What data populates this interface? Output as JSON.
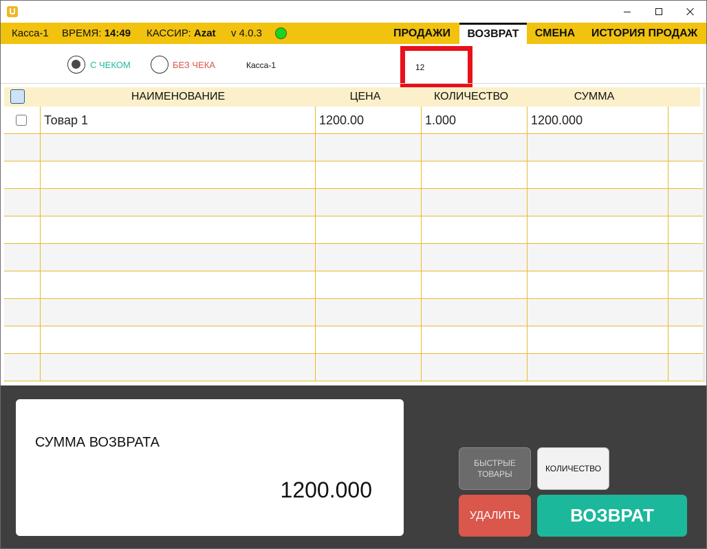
{
  "window": {
    "logo_icon": "app-logo-u-icon",
    "controls": [
      "minimize-icon",
      "maximize-icon",
      "close-icon"
    ]
  },
  "header": {
    "register": "Касса-1",
    "time_label": "ВРЕМЯ:",
    "time_value": "14:49",
    "cashier_label": "КАССИР:",
    "cashier_value": "Azat",
    "version": "v 4.0.3",
    "status_color": "#1ed31e",
    "bar_color": "#f1c20e",
    "tabs": [
      {
        "label": "ПРОДАЖИ",
        "active": false
      },
      {
        "label": "ВОЗВРАТ",
        "active": true
      },
      {
        "label": "СМЕНА",
        "active": false
      },
      {
        "label": "ИСТОРИЯ ПРОДАЖ",
        "active": false
      }
    ]
  },
  "toolbar": {
    "radio_with_receipt": {
      "label": "С ЧЕКОМ",
      "checked": true,
      "color": "#1cb89b"
    },
    "radio_without_receipt": {
      "label": "БЕЗ ЧЕКА",
      "checked": false,
      "color": "#d9574b"
    },
    "register_name": "Касса-1",
    "receipt_number": "12"
  },
  "table": {
    "columns": [
      "НАИМЕНОВАНИЕ",
      "ЦЕНА",
      "КОЛИЧЕСТВО",
      "СУММА"
    ],
    "rows": [
      {
        "name": "Товар 1",
        "price": "1200.00",
        "quantity": "1.000",
        "sum": "1200.000",
        "checked": false
      },
      {
        "name": "",
        "price": "",
        "quantity": "",
        "sum": ""
      },
      {
        "name": "",
        "price": "",
        "quantity": "",
        "sum": ""
      },
      {
        "name": "",
        "price": "",
        "quantity": "",
        "sum": ""
      },
      {
        "name": "",
        "price": "",
        "quantity": "",
        "sum": ""
      },
      {
        "name": "",
        "price": "",
        "quantity": "",
        "sum": ""
      },
      {
        "name": "",
        "price": "",
        "quantity": "",
        "sum": ""
      },
      {
        "name": "",
        "price": "",
        "quantity": "",
        "sum": ""
      },
      {
        "name": "",
        "price": "",
        "quantity": "",
        "sum": ""
      },
      {
        "name": "",
        "price": "",
        "quantity": "",
        "sum": ""
      }
    ]
  },
  "summary": {
    "label": "СУММА ВОЗВРАТА",
    "value": "1200.000"
  },
  "actions": {
    "quick_goods_line1": "БЫСТРЫЕ",
    "quick_goods_line2": "ТОВАРЫ",
    "quantity": "КОЛИЧЕСТВО",
    "delete": "УДАЛИТЬ",
    "return": "ВОЗВРАТ",
    "return_color": "#1cb89b",
    "delete_color": "#d9574b"
  }
}
